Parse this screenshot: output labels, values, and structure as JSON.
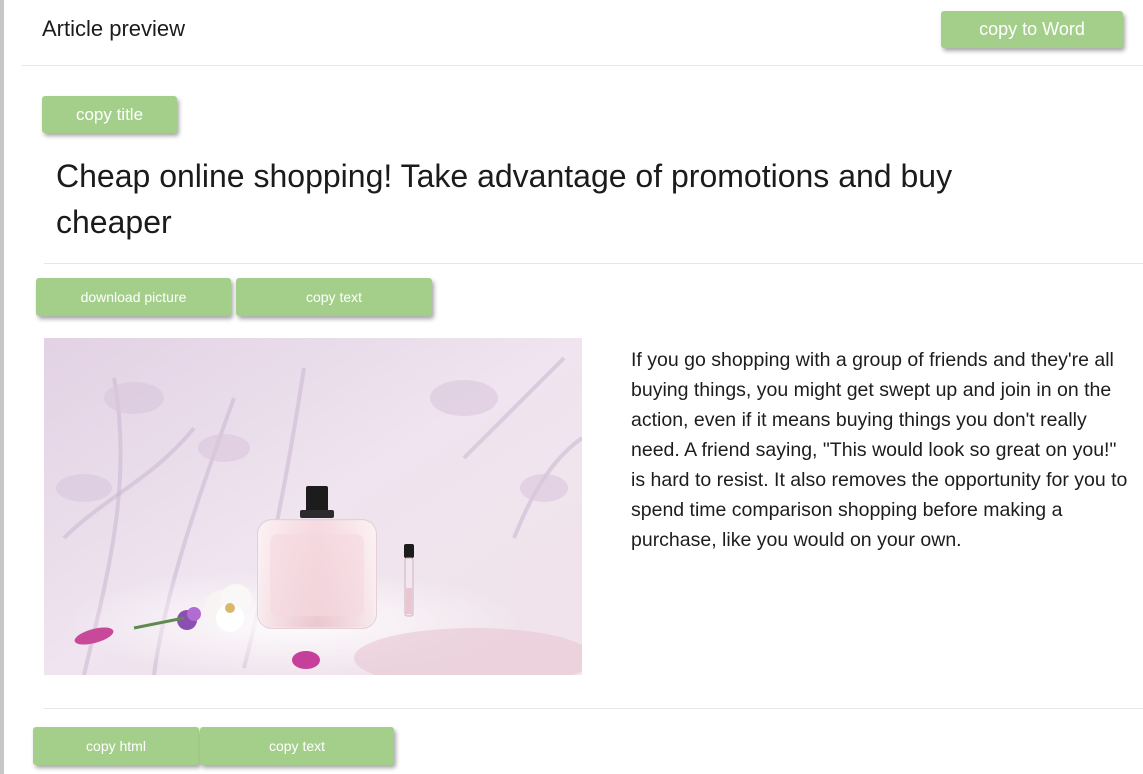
{
  "header": {
    "title": "Article preview",
    "copy_to_word_label": "copy to Word"
  },
  "title_section": {
    "copy_title_label": "copy title",
    "title": "Cheap online shopping! Take advantage of promotions and buy cheaper"
  },
  "content_toolbar": {
    "download_picture_label": "download picture",
    "copy_text_label": "copy text"
  },
  "article": {
    "image_icon": "perfume-bottle-photo",
    "body": "If you go shopping with a group of friends and they're all buying things, you might get swept up and join in on the action, even if it means buying things you don't really need. A friend saying, \"This would look so great on you!\" is hard to resist. It also removes the opportunity for you to spend time comparison shopping before making a purchase, like you would on your own."
  },
  "footer_toolbar": {
    "copy_html_label": "copy html",
    "copy_text_label": "copy text"
  },
  "colors": {
    "button_bg": "#a4cf8a",
    "button_text": "#ffffff",
    "separator": "#e6e6e6"
  }
}
